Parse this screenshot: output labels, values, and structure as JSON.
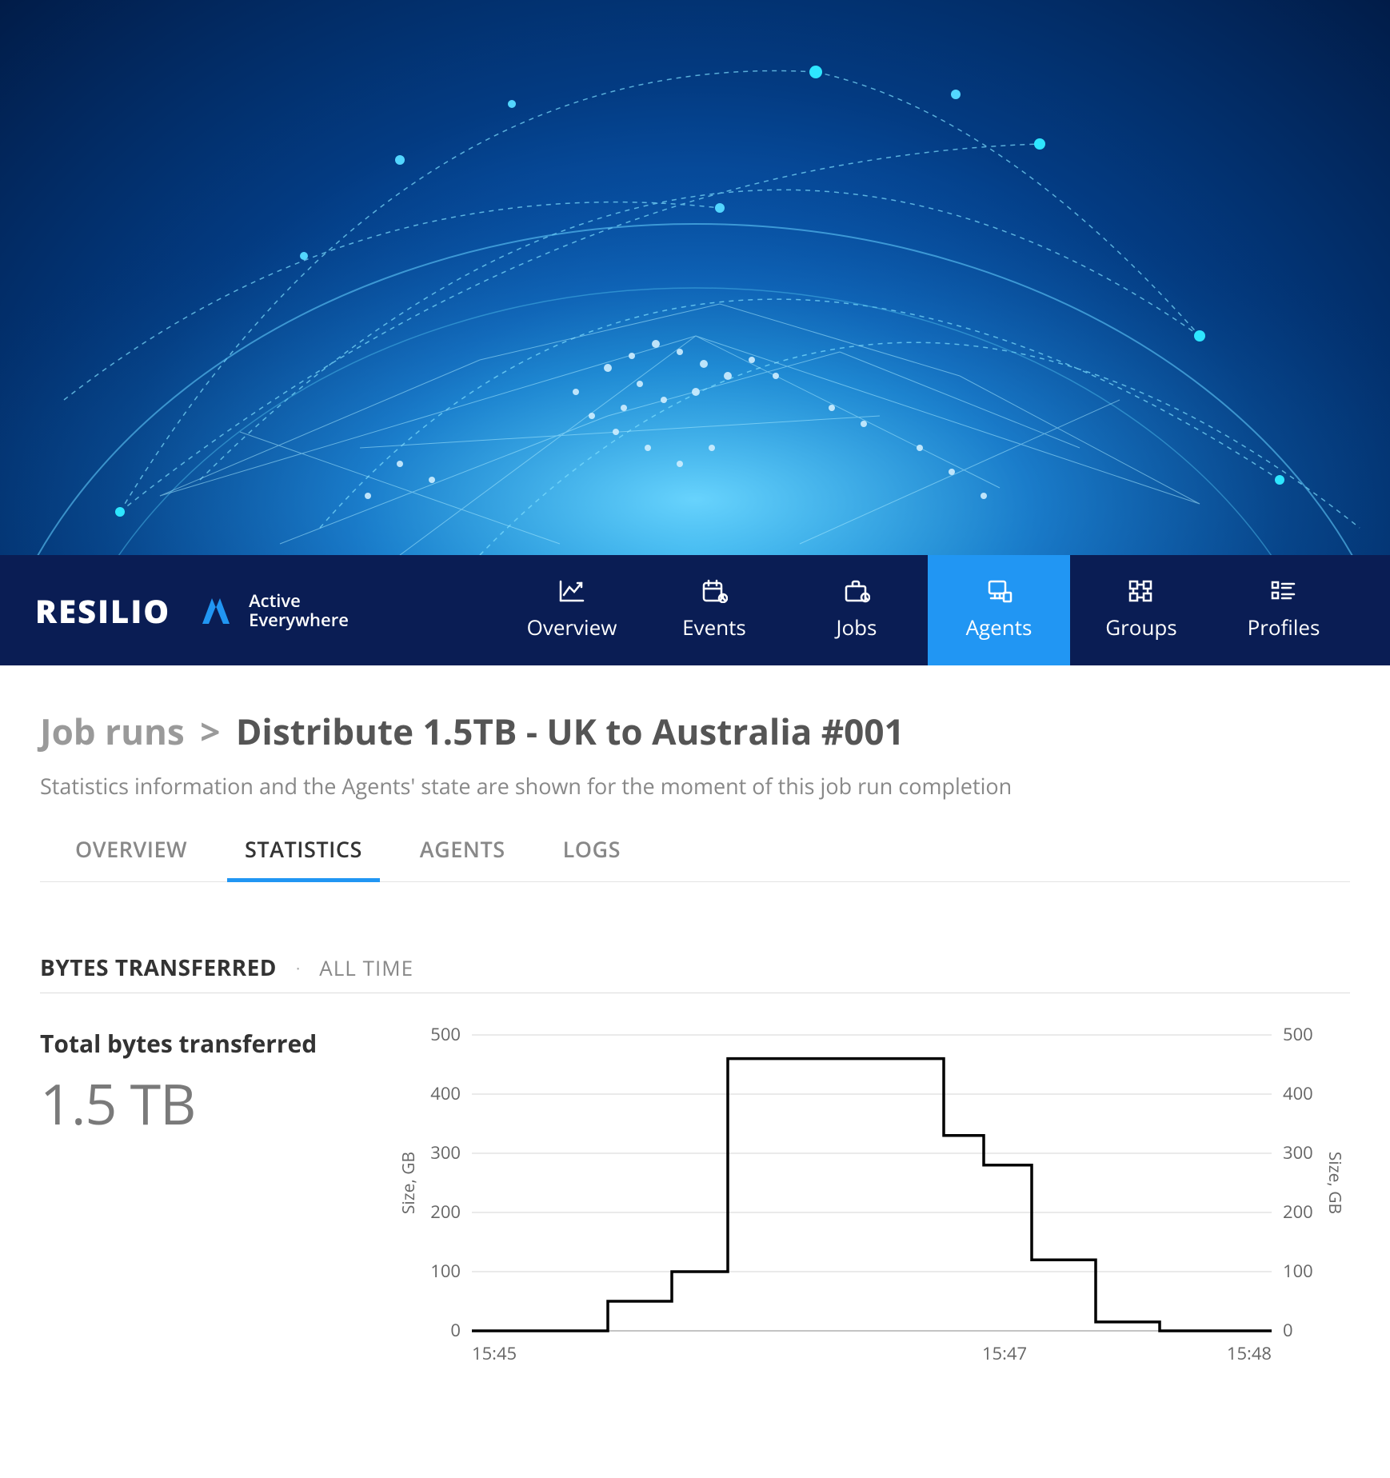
{
  "brand": {
    "name": "RESILIO",
    "tagline_line1": "Active",
    "tagline_line2": "Everywhere"
  },
  "nav": [
    {
      "label": "Overview",
      "icon": "chart-line-icon",
      "active": false
    },
    {
      "label": "Events",
      "icon": "calendar-icon",
      "active": false
    },
    {
      "label": "Jobs",
      "icon": "briefcase-icon",
      "active": false
    },
    {
      "label": "Agents",
      "icon": "agents-icon",
      "active": true
    },
    {
      "label": "Groups",
      "icon": "groups-icon",
      "active": false
    },
    {
      "label": "Profiles",
      "icon": "profiles-icon",
      "active": false
    }
  ],
  "breadcrumb": {
    "root": "Job runs",
    "sep": ">",
    "current": "Distribute 1.5TB - UK to Australia #001"
  },
  "subhead": "Statistics information and the Agents' state are shown for the moment of this job run completion",
  "subtabs": [
    {
      "label": "OVERVIEW",
      "active": false
    },
    {
      "label": "STATISTICS",
      "active": true
    },
    {
      "label": "AGENTS",
      "active": false
    },
    {
      "label": "LOGS",
      "active": false
    }
  ],
  "section": {
    "title": "BYTES TRANSFERRED",
    "dot": "·",
    "filter": "ALL TIME"
  },
  "stat": {
    "label": "Total bytes transferred",
    "value": "1.5 TB"
  },
  "chart_data": {
    "type": "line",
    "title": "",
    "xlabel": "",
    "ylabel_left": "Size, GB",
    "ylabel_right": "Size, GB",
    "ylim": [
      0,
      500
    ],
    "y_ticks": [
      0,
      100,
      200,
      300,
      400,
      500
    ],
    "x_ticks": [
      "15:45",
      "15:47",
      "15:48"
    ],
    "x_tick_positions": [
      0.0,
      0.666,
      1.0
    ],
    "series": [
      {
        "name": "Bytes Transferred",
        "points": [
          {
            "x": 0.0,
            "y": 0
          },
          {
            "x": 0.17,
            "y": 0
          },
          {
            "x": 0.17,
            "y": 50
          },
          {
            "x": 0.25,
            "y": 50
          },
          {
            "x": 0.25,
            "y": 100
          },
          {
            "x": 0.32,
            "y": 100
          },
          {
            "x": 0.32,
            "y": 460
          },
          {
            "x": 0.59,
            "y": 460
          },
          {
            "x": 0.59,
            "y": 330
          },
          {
            "x": 0.64,
            "y": 330
          },
          {
            "x": 0.64,
            "y": 280
          },
          {
            "x": 0.7,
            "y": 280
          },
          {
            "x": 0.7,
            "y": 120
          },
          {
            "x": 0.78,
            "y": 120
          },
          {
            "x": 0.78,
            "y": 15
          },
          {
            "x": 0.86,
            "y": 15
          },
          {
            "x": 0.86,
            "y": 0
          },
          {
            "x": 1.0,
            "y": 0
          }
        ]
      }
    ]
  }
}
